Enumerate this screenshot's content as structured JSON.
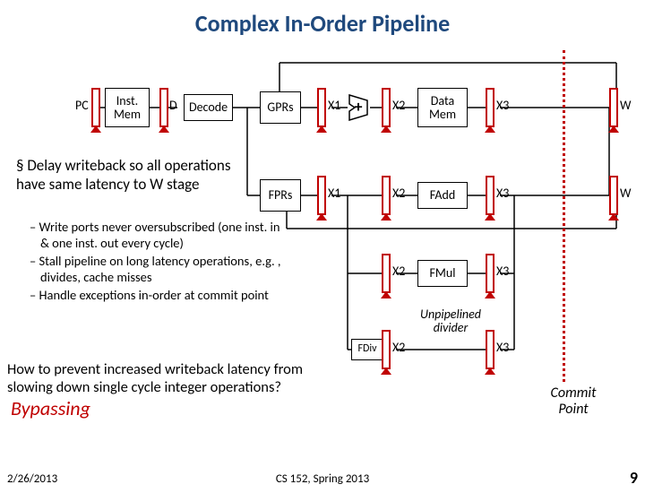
{
  "title": "Complex In-Order Pipeline",
  "stages": {
    "pc": "PC",
    "imem": "Inst.\nMem",
    "d": "D",
    "decode": "Decode",
    "gprs": "GPRs",
    "fprs": "FPRs",
    "x1": "X1",
    "x2": "X2",
    "x3": "X3",
    "w": "W",
    "plus": "+",
    "dmem": "Data\nMem",
    "fadd": "FAdd",
    "fmul": "FMul",
    "fdiv": "FDiv",
    "unpipe": "Unpipelined divider"
  },
  "bullet1": "Delay writeback so all operations have same latency to W stage",
  "sub1": "Write ports never oversubscribed (one inst. in & one inst. out every cycle)",
  "sub2": "Stall pipeline on long latency operations, e.g. , divides, cache misses",
  "sub3": "Handle exceptions in-order at commit point",
  "question": "How to prevent increased writeback latency from slowing down single cycle integer operations?",
  "bypass": "Bypassing",
  "commit": "Commit\nPoint",
  "footer_date": "2/26/2013",
  "footer_course": "CS 152, Spring 2013",
  "footer_page": "9"
}
